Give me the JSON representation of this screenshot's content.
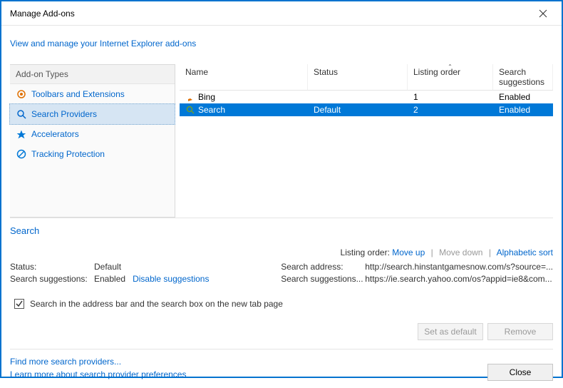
{
  "title": "Manage Add-ons",
  "subtitle_link": "View and manage your Internet Explorer add-ons",
  "sidebar": {
    "header": "Add-on Types",
    "items": [
      {
        "label": "Toolbars and Extensions"
      },
      {
        "label": "Search Providers"
      },
      {
        "label": "Accelerators"
      },
      {
        "label": "Tracking Protection"
      }
    ]
  },
  "table": {
    "headers": {
      "name": "Name",
      "status": "Status",
      "order": "Listing order",
      "sugg": "Search suggestions"
    },
    "rows": [
      {
        "name": "Bing",
        "status": "",
        "order": "1",
        "sugg": "Enabled"
      },
      {
        "name": "Search",
        "status": "Default",
        "order": "2",
        "sugg": "Enabled"
      }
    ]
  },
  "selected_name": "Search",
  "listing_order_label": "Listing order:",
  "listing_order_links": {
    "up": "Move up",
    "down": "Move down",
    "alpha": "Alphabetic sort"
  },
  "details_left": {
    "status_label": "Status:",
    "status_value": "Default",
    "sugg_label": "Search suggestions:",
    "sugg_value": "Enabled",
    "sugg_action": "Disable suggestions"
  },
  "details_right": {
    "addr_label": "Search address:",
    "addr_value": "http://search.hinstantgamesnow.com/s?source=...",
    "sugg_url_label": "Search suggestions...",
    "sugg_url_value": "https://ie.search.yahoo.com/os?appid=ie8&com..."
  },
  "checkbox_label": "Search in the address bar and the search box on the new tab page",
  "buttons": {
    "set_default": "Set as default",
    "remove": "Remove",
    "close": "Close"
  },
  "footer_links": {
    "find": "Find more search providers...",
    "learn": "Learn more about search provider preferences"
  }
}
